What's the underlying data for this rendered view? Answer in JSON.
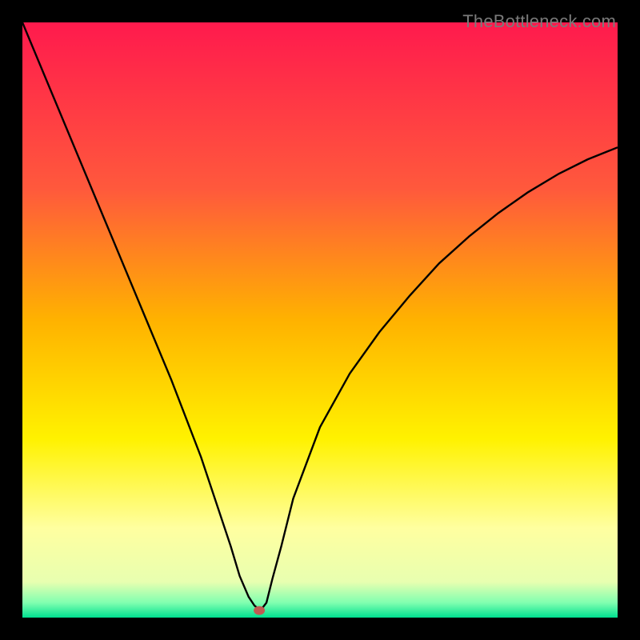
{
  "watermark": "TheBottleneck.com",
  "chart_data": {
    "type": "line",
    "title": "",
    "xlabel": "",
    "ylabel": "",
    "xlim": [
      0,
      100
    ],
    "ylim": [
      0,
      100
    ],
    "gradient_stops": [
      {
        "offset": 0,
        "color": "#ff1a4d"
      },
      {
        "offset": 28,
        "color": "#ff593c"
      },
      {
        "offset": 50,
        "color": "#ffb200"
      },
      {
        "offset": 70,
        "color": "#fff200"
      },
      {
        "offset": 85,
        "color": "#ffffa0"
      },
      {
        "offset": 94,
        "color": "#e8ffb0"
      },
      {
        "offset": 97.5,
        "color": "#80ffb0"
      },
      {
        "offset": 100,
        "color": "#00e090"
      }
    ],
    "marker": {
      "x": 39.8,
      "y": 98.8,
      "color": "#c05a52"
    },
    "series": [
      {
        "name": "curve",
        "x": [
          0,
          5,
          10,
          15,
          20,
          25,
          30,
          35,
          36.5,
          38,
          39,
          40,
          41,
          42,
          43.5,
          45.5,
          50,
          55,
          60,
          65,
          70,
          75,
          80,
          85,
          90,
          95,
          100
        ],
        "values": [
          0,
          12,
          24,
          36,
          48,
          60,
          73,
          88,
          93,
          96.5,
          98,
          98.8,
          97.5,
          93.5,
          88,
          80,
          68,
          59,
          52,
          46,
          40.5,
          36,
          32,
          28.5,
          25.5,
          23,
          21
        ]
      }
    ]
  }
}
